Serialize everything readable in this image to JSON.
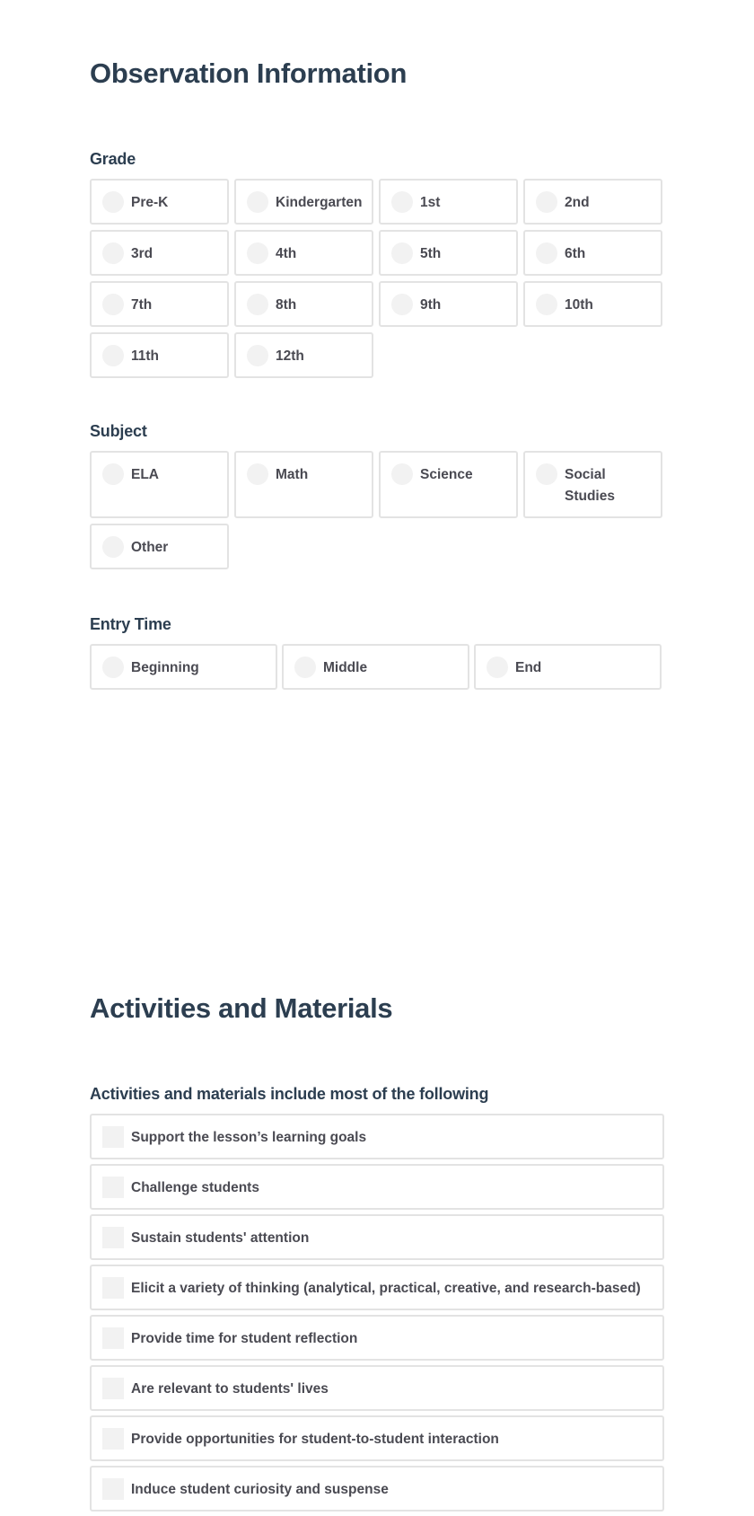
{
  "observation": {
    "title": "Observation Information",
    "grade": {
      "label": "Grade",
      "options": [
        "Pre-K",
        "Kindergarten",
        "1st",
        "2nd",
        "3rd",
        "4th",
        "5th",
        "6th",
        "7th",
        "8th",
        "9th",
        "10th",
        "11th",
        "12th"
      ]
    },
    "subject": {
      "label": "Subject",
      "options": [
        "ELA",
        "Math",
        "Science",
        "Social Studies",
        "Other"
      ]
    },
    "entry_time": {
      "label": "Entry Time",
      "options": [
        "Beginning",
        "Middle",
        "End"
      ]
    }
  },
  "activities": {
    "title": "Activities and Materials",
    "question": {
      "label": "Activities and materials include most of the following",
      "options": [
        "Support the lesson’s learning goals",
        "Challenge students",
        "Sustain students' attention",
        "Elicit a variety of thinking (analytical, practical, creative, and research-based)",
        "Provide time for student reflection",
        "Are relevant to students' lives",
        "Provide opportunities for student-to-student interaction",
        "Induce student curiosity and suspense"
      ]
    }
  },
  "colors": {
    "heading": "#2c3e50",
    "option_text": "#4a4a52",
    "border": "#e3e3e3",
    "control_fill": "#f2f2f2"
  }
}
